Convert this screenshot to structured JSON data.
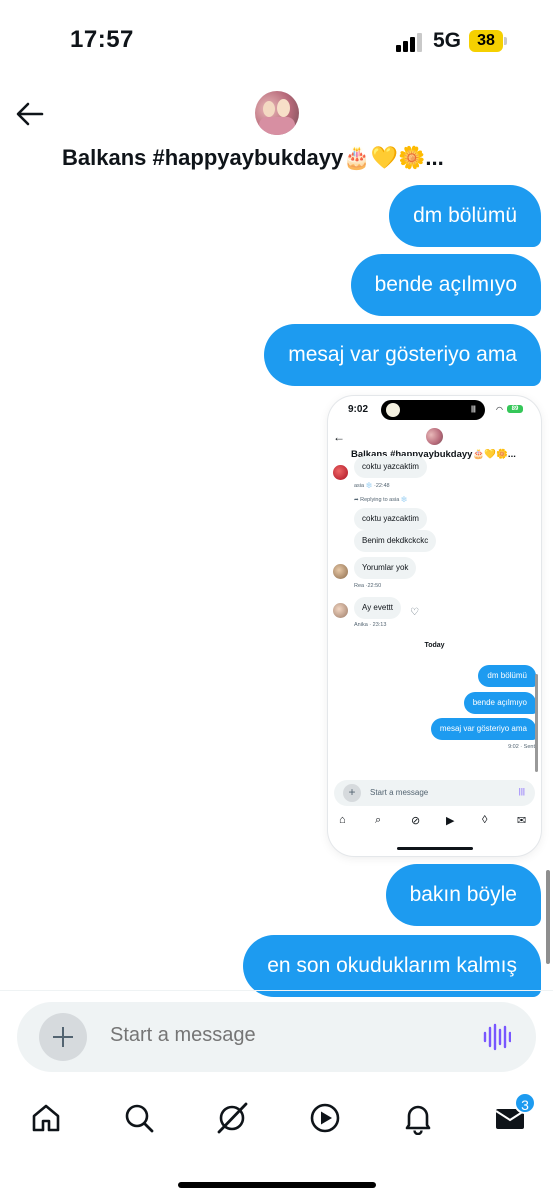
{
  "status_bar": {
    "time": "17:57",
    "network": "5G",
    "battery": "38"
  },
  "header": {
    "title": "Balkans #happyaybukdayy🎂💛🌼...",
    "back_icon": "arrow-left-icon",
    "avatar": "group-avatar"
  },
  "messages": [
    {
      "text": "dm bölümü"
    },
    {
      "text": "bende açılmıyo"
    },
    {
      "text": "mesaj var gösteriyo ama"
    },
    {
      "text": "bakın böyle"
    },
    {
      "text": "en son okuduklarım kalmış"
    }
  ],
  "attachment": {
    "status_time": "9:02",
    "battery": "89",
    "title": "Balkans #happyaybukdayy🎂💛🌼...",
    "incoming": [
      {
        "text": "coktu yazcaktim"
      },
      {
        "meta": "asia ❄️ ·22:48"
      },
      {
        "reply": "➦ Replying to asia ❄️"
      },
      {
        "text": "coktu yazcaktim"
      },
      {
        "text": "Benim dekdkckckc"
      },
      {
        "text": "Yorumlar yok"
      },
      {
        "meta": "Rea ·22:50"
      },
      {
        "text": "Ay evettt"
      },
      {
        "meta": "Anika · 23:13"
      }
    ],
    "day_separator": "Today",
    "outgoing": [
      {
        "text": "dm bölümü"
      },
      {
        "text": "bende açılmıyo"
      },
      {
        "text": "mesaj var gösteriyo ama"
      }
    ],
    "sent_meta": "9:02 · Sent",
    "composer_placeholder": "Start a message"
  },
  "composer": {
    "placeholder": "Start a message"
  },
  "nav": {
    "items": [
      "home-icon",
      "search-icon",
      "grok-icon",
      "video-icon",
      "notifications-icon",
      "messages-icon"
    ],
    "messages_badge": "3"
  },
  "colors": {
    "accent": "#1d9bf0",
    "voice": "#7856ff",
    "text": "#0f1419",
    "secondary": "#536471"
  }
}
